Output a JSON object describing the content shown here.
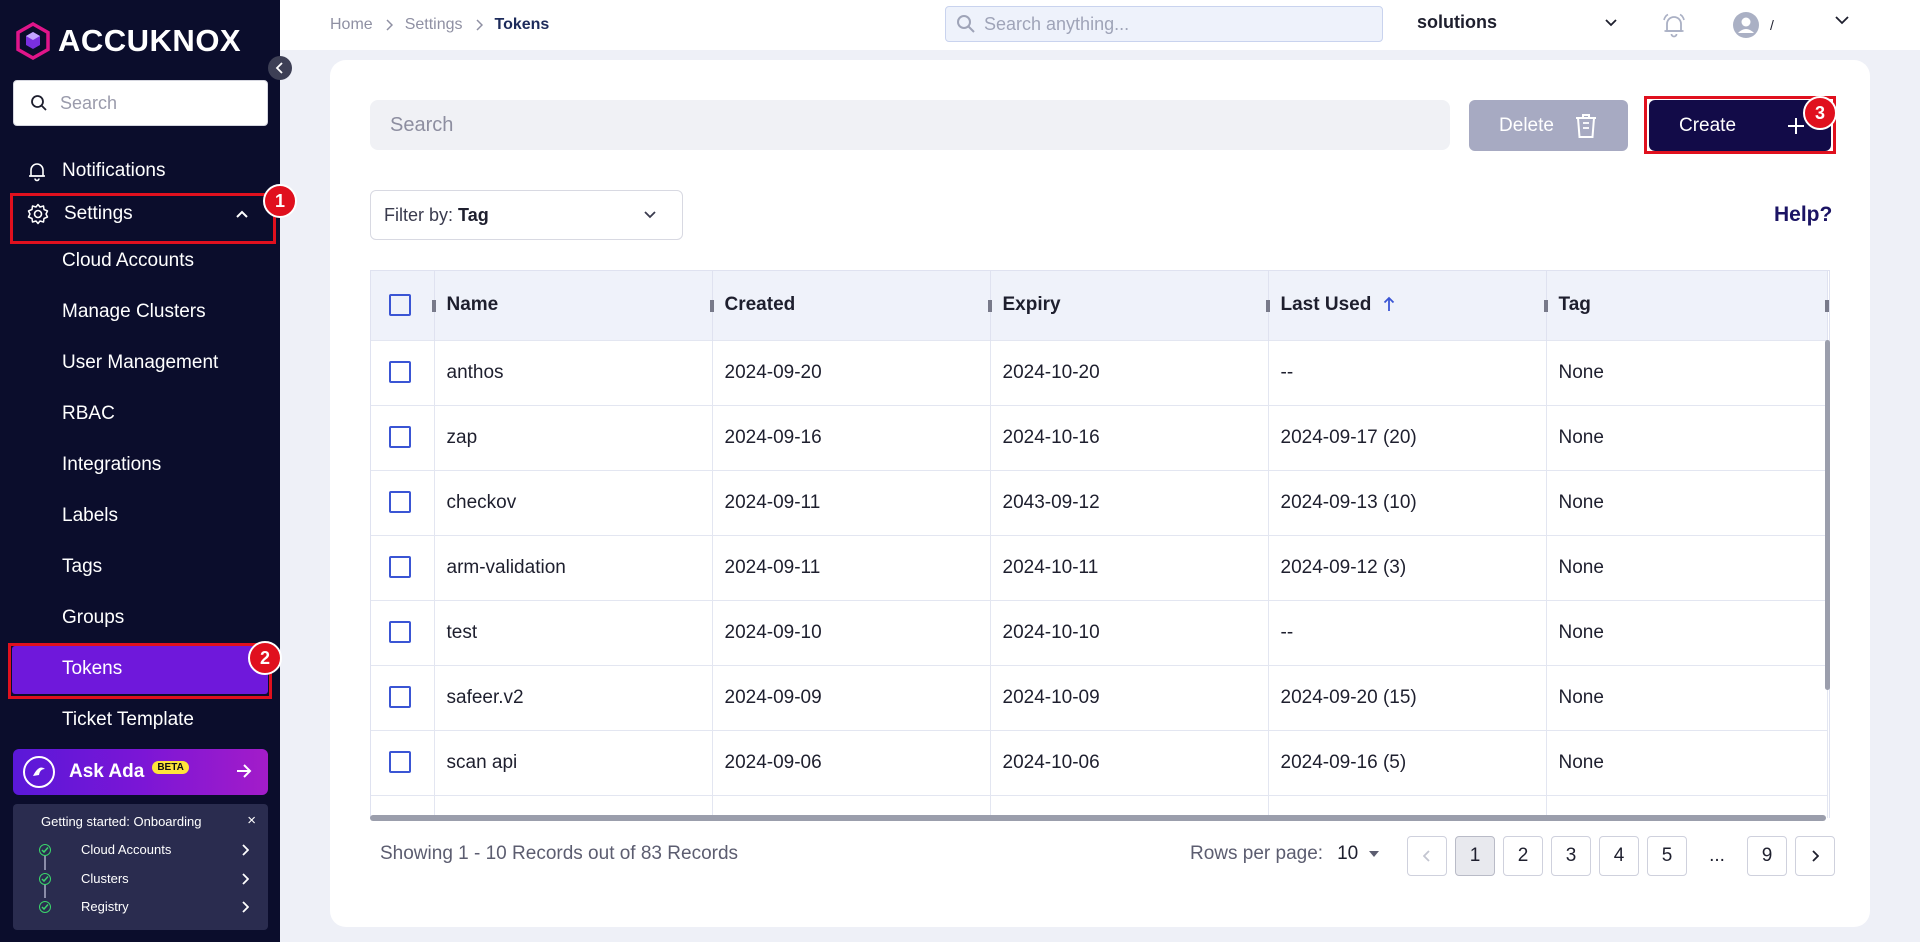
{
  "brand": {
    "name": "ACCUKNOX"
  },
  "sidebar": {
    "search_placeholder": "Search",
    "notifications_label": "Notifications",
    "settings_label": "Settings",
    "sub_items": [
      {
        "label": "Cloud Accounts"
      },
      {
        "label": "Manage Clusters"
      },
      {
        "label": "User Management"
      },
      {
        "label": "RBAC"
      },
      {
        "label": "Integrations"
      },
      {
        "label": "Labels"
      },
      {
        "label": "Tags"
      },
      {
        "label": "Groups"
      },
      {
        "label": "Tokens"
      },
      {
        "label": "Ticket Template"
      }
    ],
    "ask_ada": {
      "label": "Ask Ada",
      "badge": "BETA"
    },
    "onboarding": {
      "title": "Getting started: Onboarding",
      "close": "×",
      "steps": [
        {
          "label": "Cloud Accounts"
        },
        {
          "label": "Clusters"
        },
        {
          "label": "Registry"
        }
      ]
    }
  },
  "annotations": {
    "one": "1",
    "two": "2",
    "three": "3"
  },
  "header": {
    "breadcrumb": [
      "Home",
      "Settings",
      "Tokens"
    ],
    "search_placeholder": "Search anything...",
    "tenant": "solutions",
    "user_initial": "/"
  },
  "toolbar": {
    "search_placeholder": "Search",
    "delete_label": "Delete",
    "create_label": "Create",
    "filter_prefix": "Filter by:",
    "filter_value": "Tag",
    "help_label": "Help?"
  },
  "table": {
    "columns": [
      "Name",
      "Created",
      "Expiry",
      "Last Used",
      "Tag"
    ],
    "rows": [
      {
        "name": "anthos",
        "created": "2024-09-20",
        "expiry": "2024-10-20",
        "last_used": "--",
        "tag": "None"
      },
      {
        "name": "zap",
        "created": "2024-09-16",
        "expiry": "2024-10-16",
        "last_used": "2024-09-17 (20)",
        "tag": "None"
      },
      {
        "name": "checkov",
        "created": "2024-09-11",
        "expiry": "2043-09-12",
        "last_used": "2024-09-13 (10)",
        "tag": "None"
      },
      {
        "name": "arm-validation",
        "created": "2024-09-11",
        "expiry": "2024-10-11",
        "last_used": "2024-09-12 (3)",
        "tag": "None"
      },
      {
        "name": "test",
        "created": "2024-09-10",
        "expiry": "2024-10-10",
        "last_used": "--",
        "tag": "None"
      },
      {
        "name": "safeer.v2",
        "created": "2024-09-09",
        "expiry": "2024-10-09",
        "last_used": "2024-09-20 (15)",
        "tag": "None"
      },
      {
        "name": "scan api",
        "created": "2024-09-06",
        "expiry": "2024-10-06",
        "last_used": "2024-09-16 (5)",
        "tag": "None"
      }
    ]
  },
  "footer": {
    "showing": "Showing 1 - 10 Records out of 83 Records",
    "rows_per_page_label": "Rows per page:",
    "rows_per_page_value": "10",
    "pages": [
      "1",
      "2",
      "3",
      "4",
      "5",
      "...",
      "9"
    ],
    "current_page": "1"
  },
  "colors": {
    "sidebar_bg": "#0b0d2c",
    "active_item": "#6f18db",
    "annotation_red": "#e0101e",
    "create_button": "#120b48",
    "delete_button": "#a7aac2",
    "checkbox": "#3a55d4"
  }
}
